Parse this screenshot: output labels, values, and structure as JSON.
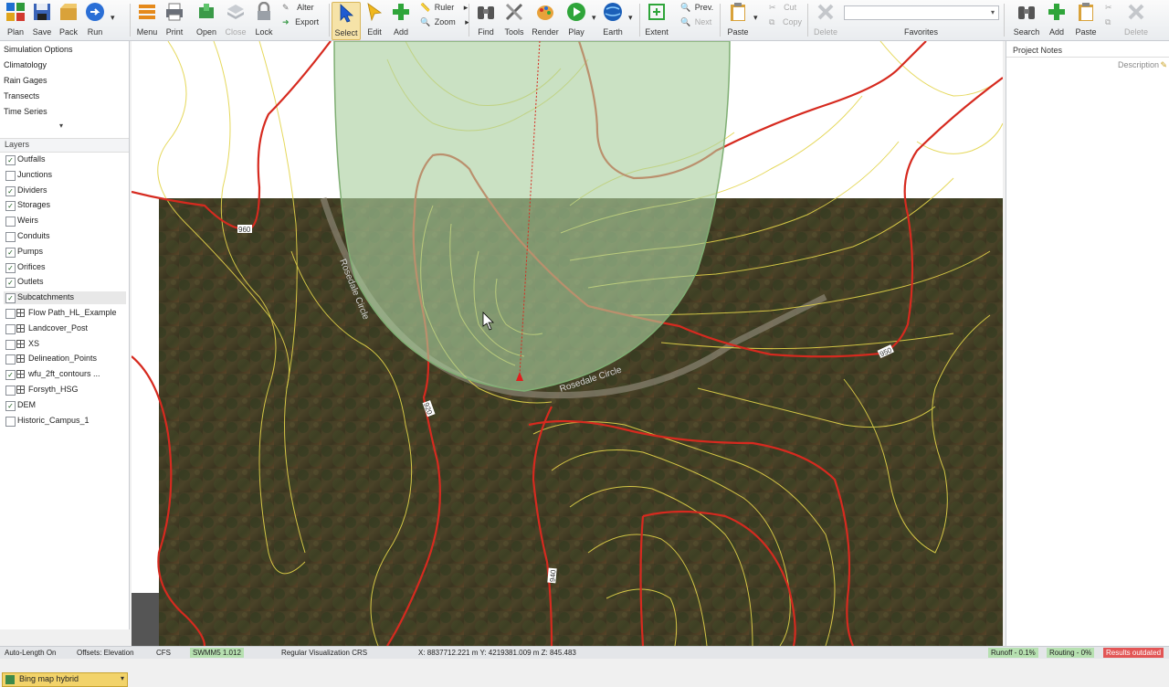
{
  "toolbar": {
    "plan": "Plan",
    "save": "Save",
    "pack": "Pack",
    "run": "Run",
    "menu": "Menu",
    "print": "Print",
    "open": "Open",
    "close": "Close",
    "lock": "Lock",
    "alter": "Alter",
    "export": "Export",
    "select": "Select",
    "edit": "Edit",
    "add": "Add",
    "ruler": "Ruler",
    "zoom": "Zoom",
    "find": "Find",
    "tools": "Tools",
    "render": "Render",
    "play": "Play",
    "earth": "Earth",
    "extent": "Extent",
    "prev": "Prev.",
    "next": "Next",
    "paste": "Paste",
    "cut": "Cut",
    "copy": "Copy",
    "delete": "Delete",
    "favorites": "Favorites"
  },
  "right_toolbar": {
    "search": "Search",
    "add": "Add",
    "paste": "Paste",
    "delete": "Delete"
  },
  "nav_items": [
    "Simulation Options",
    "Climatology",
    "Rain Gages",
    "Transects",
    "Time Series"
  ],
  "layers_title": "Layers",
  "layers": [
    {
      "label": "Outfalls",
      "checked": true,
      "grid": false
    },
    {
      "label": "Junctions",
      "checked": false,
      "grid": false
    },
    {
      "label": "Dividers",
      "checked": true,
      "grid": false
    },
    {
      "label": "Storages",
      "checked": true,
      "grid": false
    },
    {
      "label": "Weirs",
      "checked": false,
      "grid": false
    },
    {
      "label": "Conduits",
      "checked": false,
      "grid": false
    },
    {
      "label": "Pumps",
      "checked": true,
      "grid": false
    },
    {
      "label": "Orifices",
      "checked": true,
      "grid": false
    },
    {
      "label": "Outlets",
      "checked": true,
      "grid": false
    },
    {
      "label": "Subcatchments",
      "checked": true,
      "grid": false
    },
    {
      "label": "Flow Path_HL_Example",
      "checked": false,
      "grid": true
    },
    {
      "label": "Landcover_Post",
      "checked": false,
      "grid": true
    },
    {
      "label": "XS",
      "checked": false,
      "grid": true
    },
    {
      "label": "Delineation_Points",
      "checked": false,
      "grid": true
    },
    {
      "label": "wfu_2ft_contours ...",
      "checked": true,
      "grid": true
    },
    {
      "label": "Forsyth_HSG",
      "checked": false,
      "grid": true
    },
    {
      "label": "DEM",
      "checked": true,
      "grid": false
    },
    {
      "label": "Historic_Campus_1",
      "checked": false,
      "grid": false
    }
  ],
  "basemap": "Bing map hybrid",
  "map_labels": {
    "street1": "Rosedale Circle",
    "street2": "Rosedale Circle",
    "contour_labels": [
      "960",
      "950",
      "920",
      "940"
    ]
  },
  "project_notes": "Project Notes",
  "description": "Description",
  "status": {
    "auto_length": "Auto-Length On",
    "offsets": "Offsets: Elevation",
    "cfs": "CFS",
    "engine": "SWMM5 1.012",
    "visualization": "Regular Visualization CRS",
    "coords": "X: 8837712.221 m  Y: 4219381.009 m  Z: 845.483",
    "runoff": "Runoff - 0.1%",
    "routing": "Routing - 0%",
    "results": "Results outdated"
  }
}
